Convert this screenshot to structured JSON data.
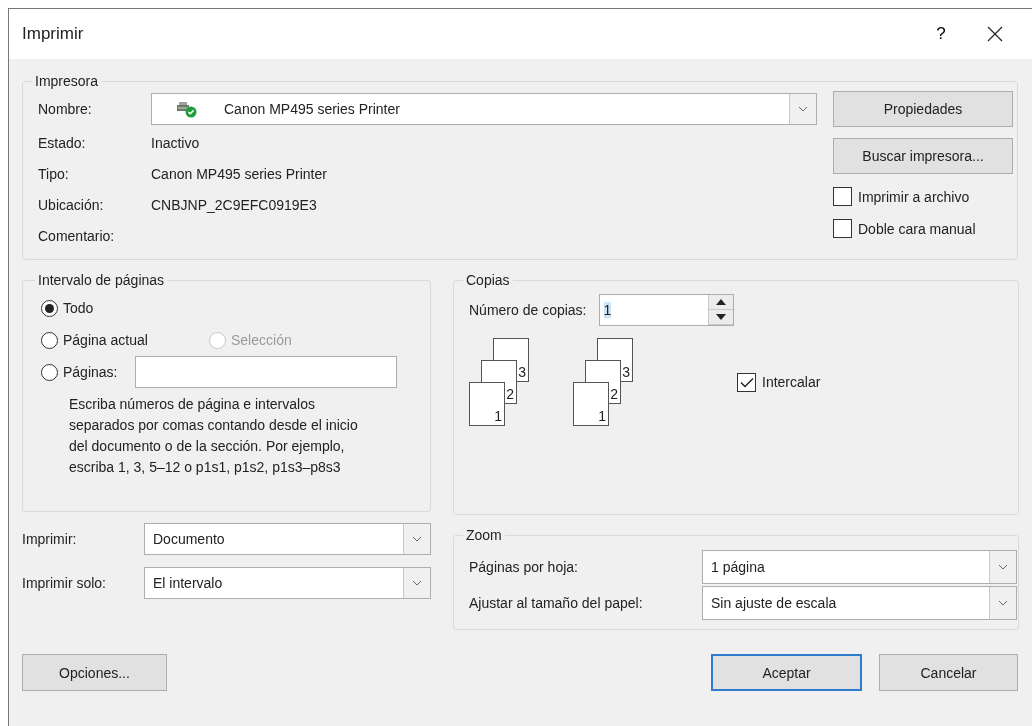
{
  "window": {
    "title": "Imprimir",
    "help": "?"
  },
  "printer": {
    "legend": "Impresora",
    "name_label": "Nombre:",
    "name_value": "Canon MP495 series Printer",
    "info": [
      {
        "label": "Estado:",
        "value": "Inactivo"
      },
      {
        "label": "Tipo:",
        "value": "Canon MP495 series Printer"
      },
      {
        "label": "Ubicación:",
        "value": "CNBJNP_2C9EFC0919E3"
      },
      {
        "label": "Comentario:"
      }
    ],
    "buttons": [
      "Propiedades",
      "Buscar impresora..."
    ],
    "options": [
      {
        "label": "Imprimir a archivo",
        "checked": false
      },
      {
        "label": "Doble cara manual",
        "checked": false
      }
    ]
  },
  "page_range": {
    "legend": "Intervalo de páginas",
    "options": [
      {
        "label": "Todo",
        "selected": true,
        "disabled": false
      },
      {
        "label": "Página actual",
        "selected": false,
        "disabled": false
      },
      {
        "label": "Selección",
        "selected": false,
        "disabled": true
      },
      {
        "label": "Páginas:",
        "selected": false,
        "disabled": false
      }
    ],
    "hint": "Escriba números de página e intervalos separados por comas contando desde el inicio del documento o de la sección. Por ejemplo, escriba 1, 3, 5–12 o p1s1, p1s2, p1s3–p8s3"
  },
  "copies": {
    "legend": "Copias",
    "count_label": "Número de copias:",
    "count_value": "1",
    "stacks": [
      [
        "1",
        "2",
        "3"
      ],
      [
        "1",
        "2",
        "3"
      ]
    ],
    "collate": {
      "label": "Intercalar",
      "checked": true
    }
  },
  "print_what": [
    {
      "label": "Imprimir:",
      "value": "Documento"
    },
    {
      "label": "Imprimir solo:",
      "value": "El intervalo"
    }
  ],
  "zoom": {
    "legend": "Zoom",
    "rows": [
      {
        "label": "Páginas por hoja:",
        "value": "1 página"
      },
      {
        "label": "Ajustar al tamaño del papel:",
        "value": "Sin ajuste de escala"
      }
    ]
  },
  "footer": [
    {
      "label": "Opciones...",
      "default": false
    },
    {
      "label": "Aceptar",
      "default": true
    },
    {
      "label": "Cancelar",
      "default": false
    }
  ]
}
